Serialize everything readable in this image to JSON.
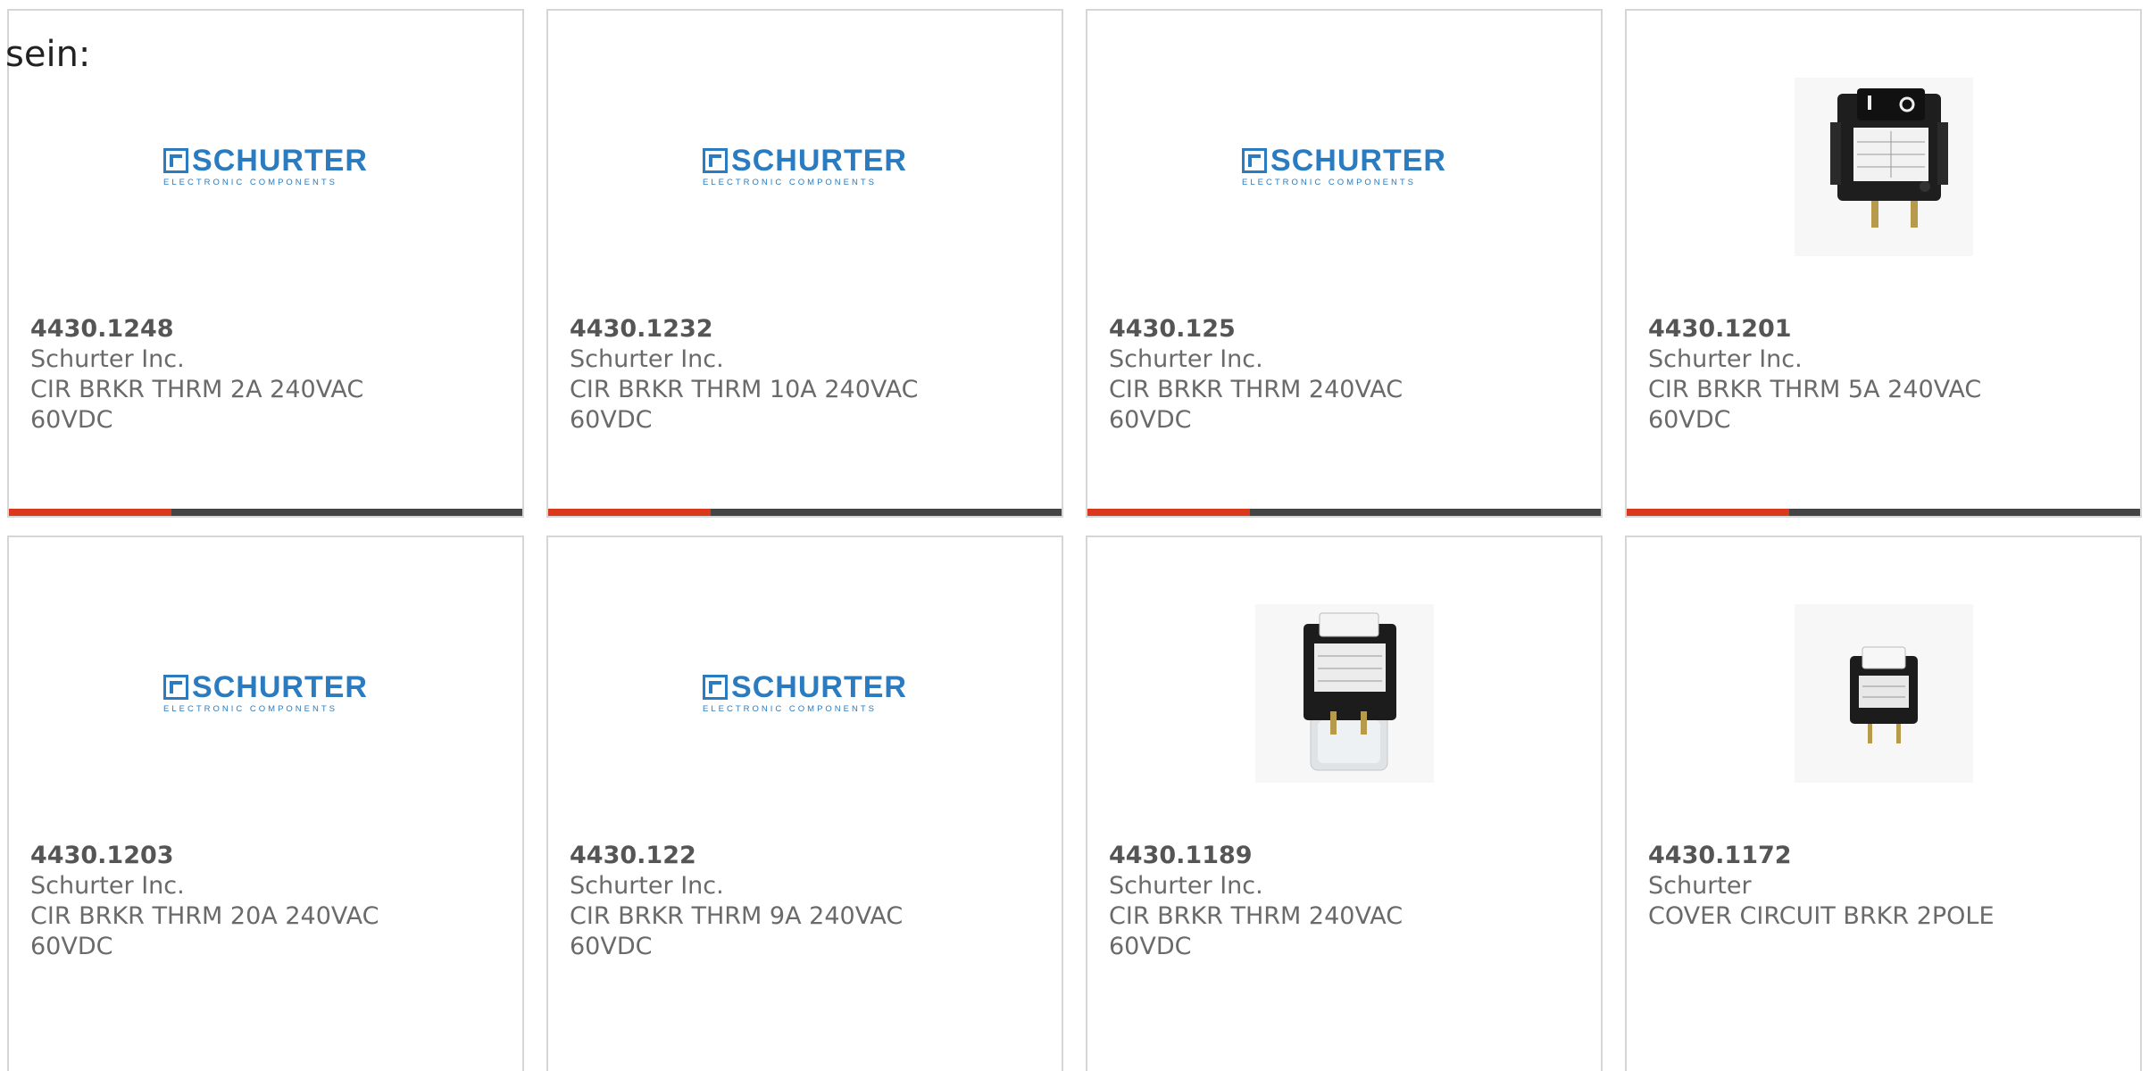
{
  "intro_text": "sein:",
  "logo": {
    "word": "SCHURTER",
    "sub": "ELECTRONIC COMPONENTS",
    "color": "#2a7bbf"
  },
  "accent_color": "#d9391a",
  "products": [
    {
      "part_number": "4430.1248",
      "manufacturer": "Schurter Inc.",
      "description": "CIR BRKR THRM 2A 240VAC 60VDC",
      "image": "schurter-logo"
    },
    {
      "part_number": "4430.1232",
      "manufacturer": "Schurter Inc.",
      "description": "CIR BRKR THRM 10A 240VAC 60VDC",
      "image": "schurter-logo"
    },
    {
      "part_number": "4430.125",
      "manufacturer": "Schurter Inc.",
      "description": "CIR BRKR THRM 240VAC 60VDC",
      "image": "schurter-logo"
    },
    {
      "part_number": "4430.1201",
      "manufacturer": "Schurter Inc.",
      "description": "CIR BRKR THRM 5A 240VAC 60VDC",
      "image": "rocker-breaker-photo"
    },
    {
      "part_number": "4430.1203",
      "manufacturer": "Schurter Inc.",
      "description": "CIR BRKR THRM 20A 240VAC 60VDC",
      "image": "schurter-logo"
    },
    {
      "part_number": "4430.122",
      "manufacturer": "Schurter Inc.",
      "description": "CIR BRKR THRM 9A 240VAC 60VDC",
      "image": "schurter-logo"
    },
    {
      "part_number": "4430.1189",
      "manufacturer": "Schurter Inc.",
      "description": "CIR BRKR THRM 240VAC 60VDC",
      "image": "breaker-with-cover-photo"
    },
    {
      "part_number": "4430.1172",
      "manufacturer": "Schurter",
      "description": "COVER CIRCUIT BRKR 2POLE",
      "image": "small-breaker-photo"
    }
  ]
}
